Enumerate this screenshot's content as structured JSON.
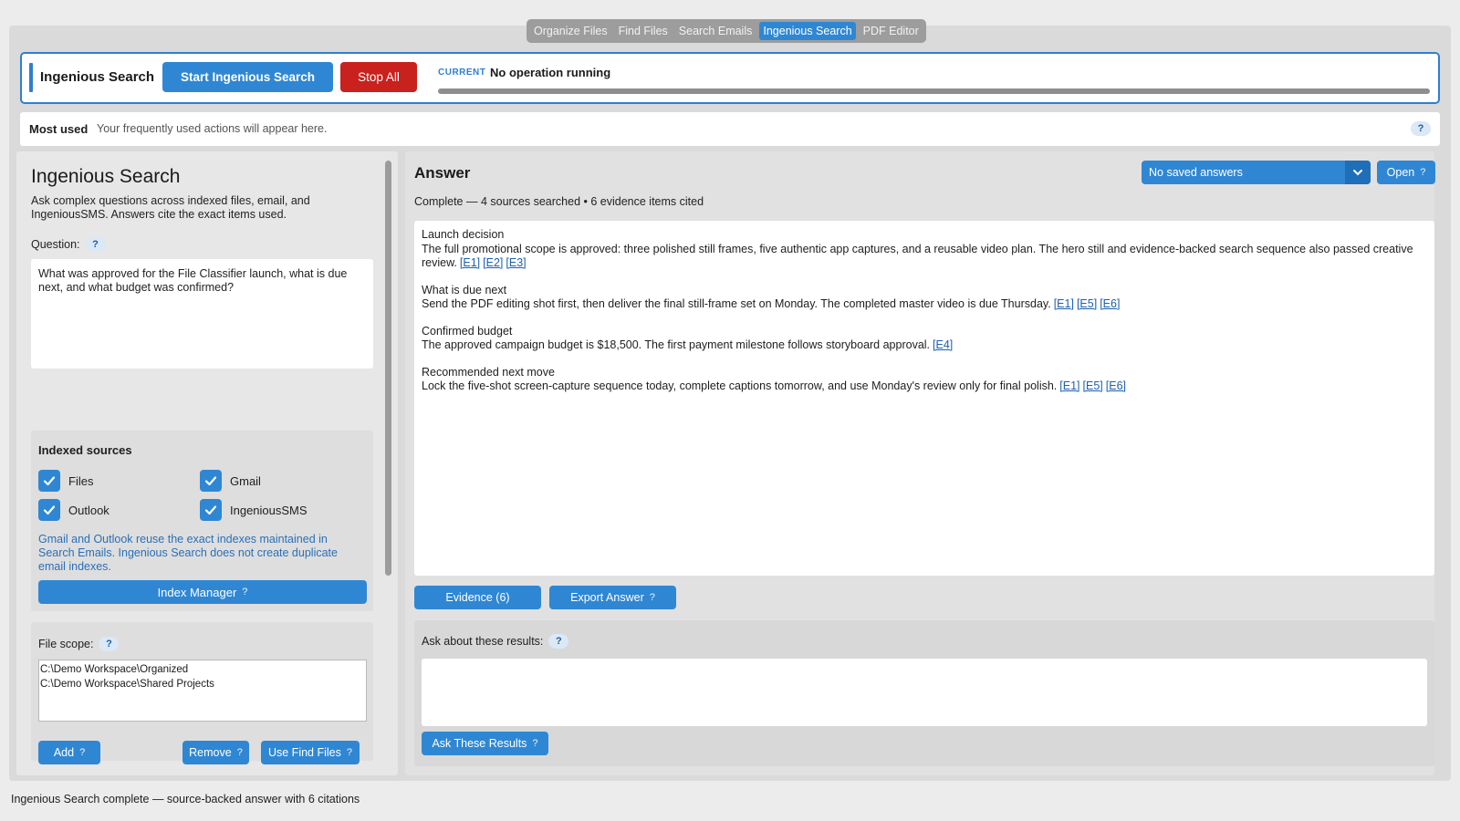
{
  "tabs": [
    {
      "label": "Organize Files",
      "active": false
    },
    {
      "label": "Find Files",
      "active": false
    },
    {
      "label": "Search Emails",
      "active": false
    },
    {
      "label": "Ingenious Search",
      "active": true
    },
    {
      "label": "PDF Editor",
      "active": false
    }
  ],
  "header": {
    "title": "Ingenious Search",
    "start_label": "Start Ingenious Search",
    "stop_label": "Stop All",
    "current_label": "CURRENT",
    "current_status": "No operation running"
  },
  "most_used": {
    "label": "Most used",
    "hint": "Your frequently used actions will appear here.",
    "help": "?"
  },
  "left": {
    "title": "Ingenious Search",
    "description": "Ask complex questions across indexed files, email, and IngeniousSMS. Answers cite the exact items used.",
    "question_label": "Question:",
    "question_value": "What was approved for the File Classifier launch, what is due next, and what budget was confirmed?",
    "sources_title": "Indexed sources",
    "sources": [
      {
        "label": "Files",
        "checked": true
      },
      {
        "label": "Gmail",
        "checked": true
      },
      {
        "label": "Outlook",
        "checked": true
      },
      {
        "label": "IngeniousSMS",
        "checked": true
      }
    ],
    "sources_note": "Gmail and Outlook reuse the exact indexes maintained in Search Emails. Ingenious Search does not create duplicate email indexes.",
    "index_manager_label": "Index Manager",
    "scope_label": "File scope:",
    "scope_paths": [
      "C:\\Demo Workspace\\Organized",
      "C:\\Demo Workspace\\Shared Projects"
    ],
    "add_label": "Add",
    "remove_label": "Remove",
    "use_find_label": "Use Find Files"
  },
  "answer": {
    "title": "Answer",
    "status": "Complete — 4 sources searched • 6 evidence items cited",
    "saved_select": "No saved answers",
    "open_label": "Open",
    "sections": [
      {
        "heading": "Launch decision",
        "text": "The full promotional scope is approved: three polished still frames, five authentic app captures, and a reusable video plan. The hero still and evidence-backed search sequence also passed creative review.",
        "cites": [
          "[E1]",
          "[E2]",
          "[E3]"
        ]
      },
      {
        "heading": "What is due next",
        "text": "Send the PDF editing shot first, then deliver the final still-frame set on Monday. The completed master video is due Thursday.",
        "cites": [
          "[E1]",
          "[E5]",
          "[E6]"
        ]
      },
      {
        "heading": "Confirmed budget",
        "text": "The approved campaign budget is $18,500. The first payment milestone follows storyboard approval.",
        "cites": [
          "[E4]"
        ]
      },
      {
        "heading": "Recommended next move",
        "text": "Lock the five-shot screen-capture sequence today, complete captions tomorrow, and use Monday's review only for final polish.",
        "cites": [
          "[E1]",
          "[E5]",
          "[E6]"
        ]
      }
    ],
    "evidence_label": "Evidence (6)",
    "export_label": "Export Answer",
    "ask_label": "Ask about these results:",
    "ask_value": "",
    "ask_button": "Ask These Results"
  },
  "status_bar": "Ingenious Search complete — source-backed answer with 6 citations",
  "colors": {
    "accent": "#2f87d4",
    "stop": "#c9211e",
    "link": "#1d5fb0",
    "note": "#2a6fb8"
  }
}
